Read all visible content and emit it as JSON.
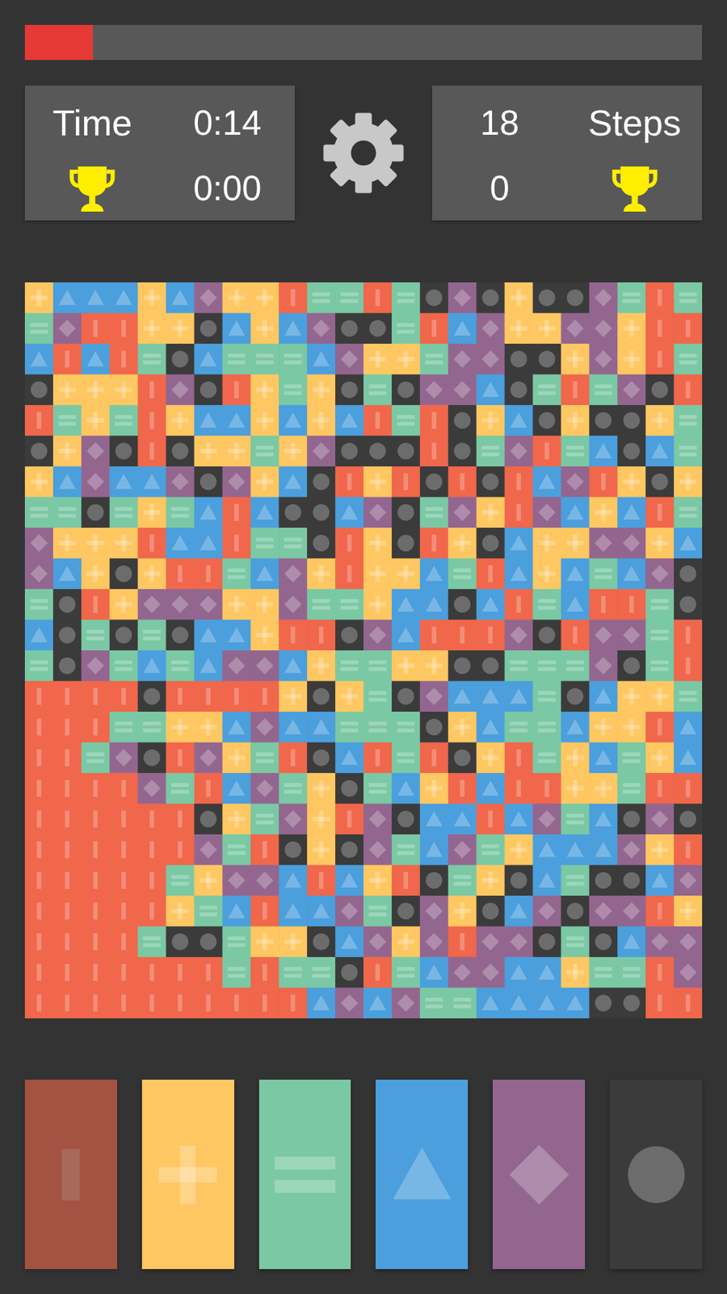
{
  "progress": {
    "level": 0.1
  },
  "time": {
    "label": "Time",
    "current": "0:14",
    "best": "0:00"
  },
  "steps": {
    "label": "Steps",
    "current": "18",
    "best": "0"
  },
  "palette": [
    {
      "kind": "bar",
      "color": "#f0674b",
      "disabled": true
    },
    {
      "kind": "plus",
      "color": "#fec761",
      "disabled": false
    },
    {
      "kind": "equals",
      "color": "#7bc8a4",
      "disabled": false
    },
    {
      "kind": "triangle",
      "color": "#4b9fdc",
      "disabled": false
    },
    {
      "kind": "diamond",
      "color": "#93668f",
      "disabled": false
    },
    {
      "kind": "circle",
      "color": "#3b3b3b",
      "disabled": false
    }
  ],
  "board": {
    "rows": [
      [
        1,
        3,
        3,
        3,
        1,
        3,
        4,
        1,
        1,
        0,
        2,
        2,
        0,
        2,
        5,
        4,
        5,
        1,
        5,
        5,
        4,
        2,
        0,
        2
      ],
      [
        2,
        4,
        0,
        0,
        1,
        1,
        5,
        3,
        1,
        3,
        4,
        5,
        5,
        2,
        0,
        3,
        4,
        1,
        1,
        4,
        4,
        1,
        0,
        0
      ],
      [
        3,
        0,
        3,
        0,
        2,
        5,
        3,
        2,
        2,
        2,
        3,
        4,
        1,
        1,
        2,
        4,
        4,
        5,
        5,
        1,
        4,
        1,
        0,
        2
      ],
      [
        5,
        1,
        1,
        1,
        0,
        4,
        5,
        0,
        1,
        2,
        1,
        5,
        2,
        5,
        4,
        4,
        3,
        5,
        2,
        0,
        2,
        4,
        5,
        0
      ],
      [
        0,
        2,
        1,
        2,
        0,
        1,
        3,
        3,
        1,
        3,
        1,
        3,
        0,
        2,
        0,
        5,
        1,
        3,
        5,
        1,
        5,
        5,
        1,
        2
      ],
      [
        5,
        1,
        4,
        5,
        0,
        5,
        1,
        1,
        2,
        1,
        4,
        5,
        5,
        5,
        0,
        5,
        2,
        4,
        0,
        2,
        3,
        5,
        3,
        2
      ],
      [
        1,
        3,
        4,
        3,
        3,
        4,
        5,
        4,
        1,
        3,
        5,
        0,
        1,
        0,
        5,
        0,
        5,
        0,
        3,
        4,
        0,
        1,
        5,
        1
      ],
      [
        2,
        2,
        5,
        2,
        1,
        2,
        3,
        0,
        3,
        5,
        5,
        3,
        4,
        5,
        2,
        4,
        1,
        0,
        4,
        3,
        1,
        3,
        0,
        2
      ],
      [
        4,
        1,
        1,
        1,
        0,
        3,
        3,
        0,
        2,
        2,
        5,
        0,
        1,
        5,
        0,
        1,
        5,
        3,
        1,
        1,
        4,
        4,
        1,
        3
      ],
      [
        4,
        3,
        1,
        5,
        1,
        0,
        0,
        2,
        3,
        4,
        1,
        0,
        1,
        1,
        3,
        2,
        0,
        3,
        1,
        3,
        2,
        3,
        4,
        5
      ],
      [
        2,
        5,
        0,
        1,
        4,
        4,
        4,
        1,
        1,
        4,
        2,
        2,
        1,
        3,
        3,
        5,
        3,
        0,
        2,
        3,
        0,
        0,
        2,
        5
      ],
      [
        3,
        5,
        2,
        5,
        2,
        5,
        3,
        3,
        1,
        0,
        0,
        5,
        4,
        3,
        0,
        0,
        0,
        4,
        5,
        0,
        4,
        4,
        2,
        0
      ],
      [
        2,
        5,
        4,
        2,
        3,
        2,
        3,
        4,
        4,
        3,
        1,
        2,
        2,
        1,
        1,
        5,
        5,
        2,
        2,
        2,
        4,
        5,
        2,
        0
      ],
      [
        0,
        0,
        0,
        0,
        5,
        0,
        0,
        0,
        0,
        1,
        5,
        1,
        2,
        5,
        4,
        3,
        3,
        3,
        2,
        5,
        3,
        1,
        1,
        2
      ],
      [
        0,
        0,
        0,
        2,
        2,
        1,
        1,
        3,
        4,
        3,
        3,
        2,
        2,
        2,
        5,
        1,
        3,
        2,
        2,
        3,
        1,
        1,
        0,
        3
      ],
      [
        0,
        0,
        2,
        4,
        5,
        0,
        4,
        1,
        2,
        0,
        5,
        3,
        0,
        2,
        0,
        5,
        1,
        0,
        2,
        1,
        3,
        2,
        1,
        3
      ],
      [
        0,
        0,
        0,
        0,
        4,
        2,
        0,
        3,
        4,
        2,
        1,
        5,
        2,
        3,
        1,
        0,
        3,
        0,
        0,
        1,
        1,
        2,
        0,
        0
      ],
      [
        0,
        0,
        0,
        0,
        0,
        0,
        5,
        1,
        2,
        4,
        1,
        0,
        4,
        5,
        3,
        3,
        0,
        3,
        4,
        2,
        3,
        5,
        4,
        5
      ],
      [
        0,
        0,
        0,
        0,
        0,
        0,
        4,
        2,
        0,
        5,
        1,
        5,
        4,
        2,
        3,
        4,
        2,
        1,
        3,
        3,
        3,
        4,
        1,
        0
      ],
      [
        0,
        0,
        0,
        0,
        0,
        2,
        1,
        4,
        4,
        3,
        0,
        3,
        1,
        0,
        5,
        2,
        1,
        5,
        3,
        2,
        5,
        5,
        3,
        4
      ],
      [
        0,
        0,
        0,
        0,
        0,
        1,
        2,
        3,
        0,
        3,
        3,
        4,
        2,
        5,
        4,
        1,
        5,
        3,
        4,
        5,
        4,
        4,
        0,
        1
      ],
      [
        0,
        0,
        0,
        0,
        2,
        5,
        5,
        2,
        1,
        1,
        5,
        3,
        4,
        1,
        4,
        0,
        4,
        4,
        5,
        2,
        5,
        3,
        4,
        4
      ],
      [
        0,
        0,
        0,
        0,
        0,
        0,
        0,
        2,
        0,
        2,
        2,
        5,
        0,
        2,
        3,
        4,
        4,
        3,
        3,
        1,
        2,
        2,
        0,
        4
      ],
      [
        0,
        0,
        0,
        0,
        0,
        0,
        0,
        0,
        0,
        0,
        3,
        4,
        3,
        4,
        2,
        2,
        3,
        3,
        3,
        3,
        5,
        5,
        0,
        0
      ]
    ]
  }
}
